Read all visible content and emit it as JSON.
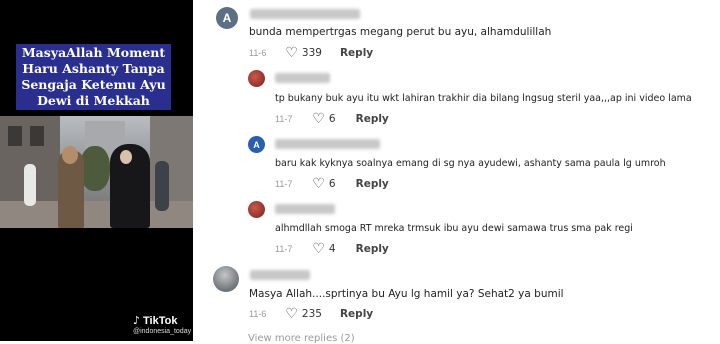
{
  "video_panel": {
    "title_lines": [
      "MasyaAllah Moment",
      "Haru Ashanty Tanpa",
      "Sengaja Ketemu Ayu",
      "Dewi di Mekkah"
    ],
    "watermark_logo": "TikTok",
    "watermark_user": "@indonesia_today"
  },
  "colors": {
    "title_card_bg": "#2a2f8f",
    "avatar_a_gray": "#5d6f84",
    "avatar_a_blue": "#2a5fb0",
    "avatar_red": "#8b2a25"
  },
  "comments": [
    {
      "avatar_icon": "letter-a-avatar",
      "avatar_letter": "A",
      "text": "bunda mempertrgas megang perut bu ayu, alhamdulillah",
      "date": "11-6",
      "likes": "339",
      "reply": "Reply"
    },
    {
      "avatar_icon": "photo-avatar",
      "text": "tp bukany buk ayu itu wkt lahiran trakhir dia bilang lngsug steril yaa,,,ap ini video lama",
      "date": "11-7",
      "likes": "6",
      "reply": "Reply"
    },
    {
      "avatar_icon": "letter-a-avatar",
      "avatar_letter": "A",
      "text": "baru kak kyknya soalnya emang di sg nya ayudewi, ashanty sama paula lg umroh",
      "date": "11-7",
      "likes": "6",
      "reply": "Reply"
    },
    {
      "avatar_icon": "photo-avatar",
      "text": "alhmdllah smoga RT mreka trmsuk ibu ayu dewi samawa trus sma pak regi",
      "date": "11-7",
      "likes": "4",
      "reply": "Reply"
    },
    {
      "avatar_icon": "photo-avatar",
      "text": "Masya Allah....sprtinya bu Ayu lg hamil ya? Sehat2 ya bumil",
      "date": "11-6",
      "likes": "235",
      "reply": "Reply"
    }
  ],
  "view_more": "View more replies (2)"
}
